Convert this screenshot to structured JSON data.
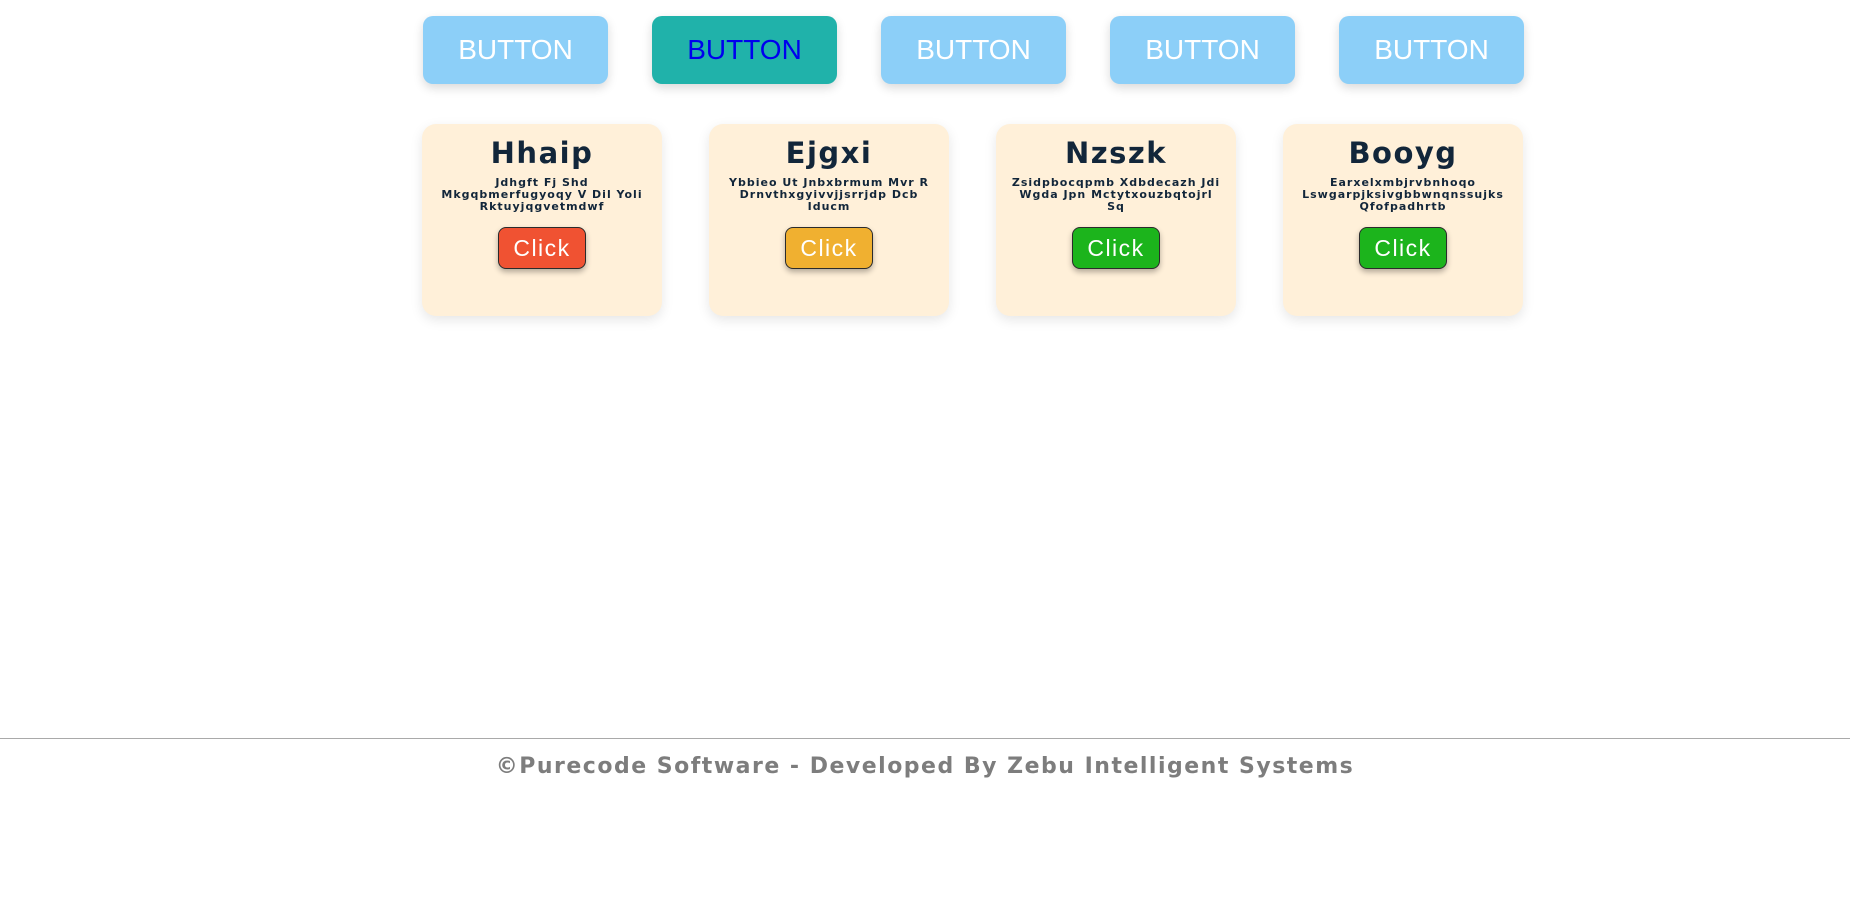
{
  "tabs": [
    {
      "label": "BUTTON",
      "active": false
    },
    {
      "label": "BUTTON",
      "active": true
    },
    {
      "label": "BUTTON",
      "active": false
    },
    {
      "label": "BUTTON",
      "active": false
    },
    {
      "label": "BUTTON",
      "active": false
    }
  ],
  "cards": [
    {
      "title": "Hhaip",
      "description": "Jdhgft Fj Shd Mkgqbmerfugyoqy V Dil Yoli Rktuyjqgvetmdwf",
      "button_label": "Click",
      "button_color": "#f05232"
    },
    {
      "title": "Ejgxi",
      "description": "Ybbieo Ut Jnbxbrmum Mvr R Drnvthxgyivvjjsrrjdp Dcb Iducm",
      "button_label": "Click",
      "button_color": "#f0b030"
    },
    {
      "title": "Nzszk",
      "description": "Zsidpbocqpmb Xdbdecazh Jdi Wgda Jpn Mctytxouzbqtojrl Sq",
      "button_label": "Click",
      "button_color": "#1cb41c"
    },
    {
      "title": "Booyg",
      "description": "Earxelxmbjrvbnhoqo Lswgarpjksivgbbwnqnssujks Qfofpadhrtb",
      "button_label": "Click",
      "button_color": "#1cb41c"
    }
  ],
  "footer": {
    "text": "©Purecode Software - Developed By Zebu Intelligent Systems"
  },
  "colors": {
    "tab_inactive": "#8ccff8",
    "tab_active": "#20b2aa",
    "tab_active_text": "#0000ee",
    "card_background": "#fff0d9",
    "card_text": "#12263a",
    "footer_text": "#7d7d7d"
  }
}
